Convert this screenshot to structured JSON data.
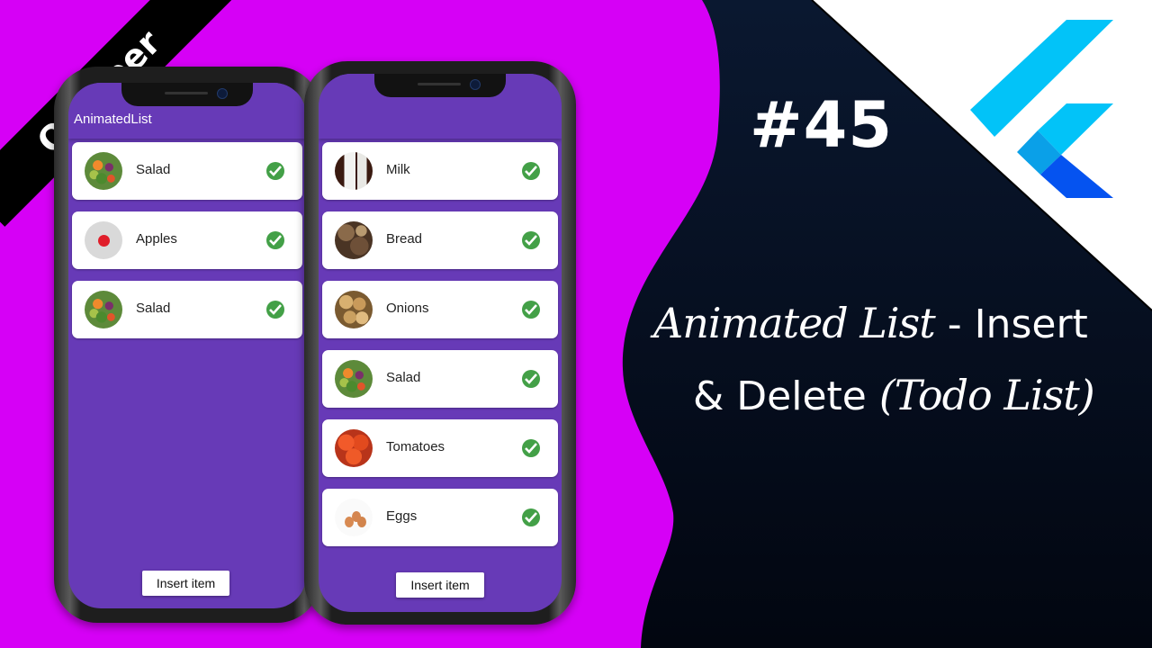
{
  "ribbon": {
    "label": "October"
  },
  "episode": {
    "number": "#45"
  },
  "title": {
    "line1_script": "Animated List",
    "line1_plain": " - Insert",
    "line2_plain": "& Delete ",
    "line2_script": "(Todo List)"
  },
  "logo": {
    "icon": "flutter-logo-icon"
  },
  "colors": {
    "background_magenta": "#d600f6",
    "background_dark": "#06101f",
    "app_purple": "#673ab7",
    "check_green": "#43a047",
    "flutter_light": "#02c3f8",
    "flutter_dark": "#0553f0"
  },
  "phone_left": {
    "appbar_title": "AnimatedList",
    "items": [
      {
        "label": "Salad",
        "image": "salad",
        "status_icon": "check-circle-icon"
      },
      {
        "label": "Apples",
        "image": "apple",
        "status_icon": "check-circle-icon"
      },
      {
        "label": "Salad",
        "image": "salad",
        "status_icon": "check-circle-icon"
      }
    ],
    "insert_button": "Insert item"
  },
  "phone_right": {
    "items": [
      {
        "label": "Milk",
        "image": "milk",
        "status_icon": "check-circle-icon"
      },
      {
        "label": "Bread",
        "image": "bread",
        "status_icon": "check-circle-icon"
      },
      {
        "label": "Onions",
        "image": "onion",
        "status_icon": "check-circle-icon"
      },
      {
        "label": "Salad",
        "image": "salad",
        "status_icon": "check-circle-icon"
      },
      {
        "label": "Tomatoes",
        "image": "tomato",
        "status_icon": "check-circle-icon"
      },
      {
        "label": "Eggs",
        "image": "eggs",
        "status_icon": "check-circle-icon"
      }
    ],
    "insert_button": "Insert item"
  }
}
